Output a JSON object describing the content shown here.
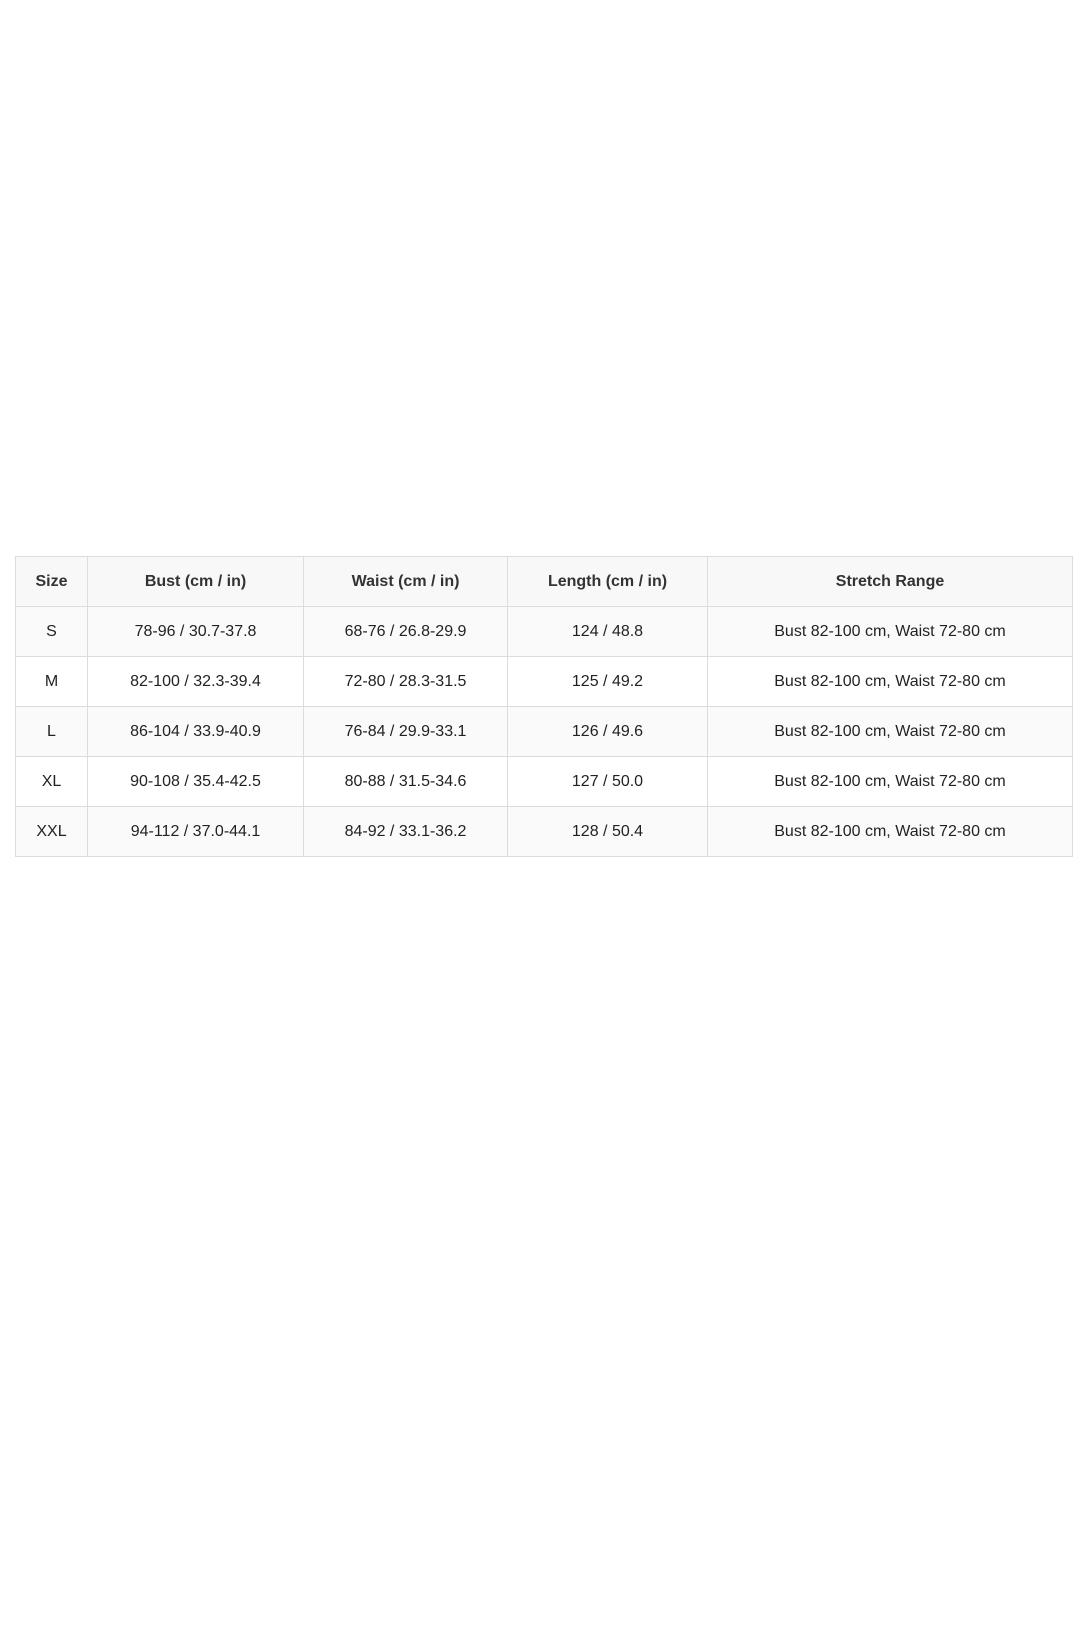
{
  "size_chart": {
    "headers": [
      "Size",
      "Bust (cm / in)",
      "Waist (cm / in)",
      "Length (cm / in)",
      "Stretch Range"
    ],
    "rows": [
      [
        "S",
        "78-96 / 30.7-37.8",
        "68-76 / 26.8-29.9",
        "124 / 48.8",
        "Bust 82-100 cm, Waist 72-80 cm"
      ],
      [
        "M",
        "82-100 / 32.3-39.4",
        "72-80 / 28.3-31.5",
        "125 / 49.2",
        "Bust 82-100 cm, Waist 72-80 cm"
      ],
      [
        "L",
        "86-104 / 33.9-40.9",
        "76-84 / 29.9-33.1",
        "126 / 49.6",
        "Bust 82-100 cm, Waist 72-80 cm"
      ],
      [
        "XL",
        "90-108 / 35.4-42.5",
        "80-88 / 31.5-34.6",
        "127 / 50.0",
        "Bust 82-100 cm, Waist 72-80 cm"
      ],
      [
        "XXL",
        "94-112 / 37.0-44.1",
        "84-92 / 33.1-36.2",
        "128 / 50.4",
        "Bust 82-100 cm, Waist 72-80 cm"
      ]
    ]
  }
}
